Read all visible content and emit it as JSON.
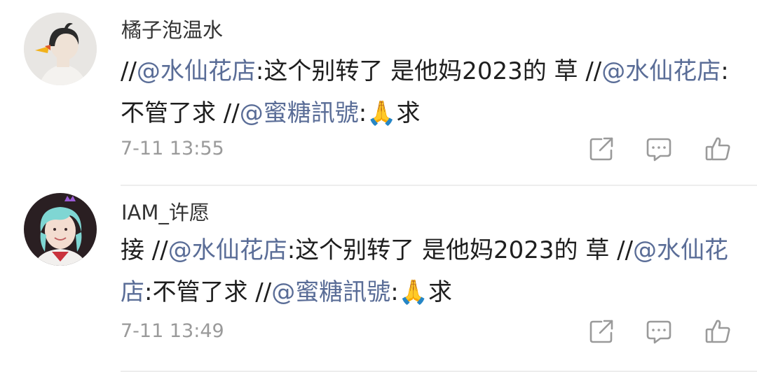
{
  "comments": [
    {
      "username": "橘子泡温水",
      "text_parts": [
        "//",
        "@水仙花店",
        ":这个别转了 是他妈2023的 草 //",
        "@水仙花店",
        ":不管了求 //",
        "@蜜糖訊號",
        ":",
        "🙏",
        "求"
      ],
      "timestamp": "7-11 13:55",
      "actions": [
        "share-icon",
        "comment-icon",
        "like-icon"
      ]
    },
    {
      "username": "IAM_许愿",
      "text_parts": [
        "接 //",
        "@水仙花店",
        ":这个别转了 是他妈2023的 草 //",
        "@水仙花店",
        ":不管了求 //",
        "@蜜糖訊號",
        ":",
        "🙏",
        "求"
      ],
      "timestamp": "7-11 13:49",
      "actions": [
        "share-icon",
        "comment-icon",
        "like-icon"
      ]
    }
  ],
  "colors": {
    "mention": "#5a6d97",
    "text": "#1e1e1e",
    "timestamp": "#9a9a9a",
    "icon": "#9a9a9a"
  }
}
